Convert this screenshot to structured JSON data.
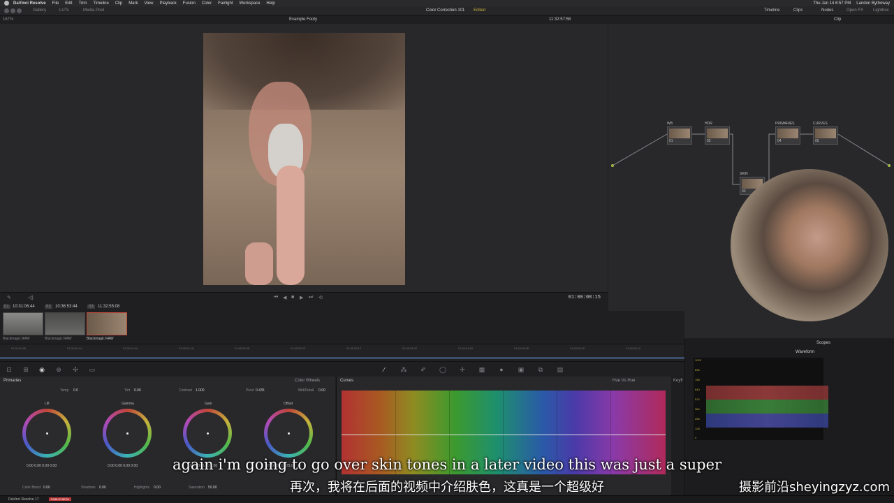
{
  "menubar": {
    "app": "DaVinci Resolve",
    "items": [
      "File",
      "Edit",
      "Trim",
      "Timeline",
      "Clip",
      "Mark",
      "View",
      "Playback",
      "Fusion",
      "Color",
      "Fairlight",
      "Workspace",
      "Help"
    ],
    "clock": "Thu Jan 14  6:57 PM",
    "user": "Landon Bythoway"
  },
  "toolbar": {
    "left": [
      "Gallery",
      "LUTs",
      "Media Pool"
    ],
    "project": "Color Correction 101",
    "status": "Edited",
    "right": [
      "Timeline",
      "Clips",
      "Nodes",
      "Open FX",
      "Lightbox"
    ]
  },
  "viewer": {
    "zoom": "167%",
    "clip_name": "Example Footy",
    "timecode_top": "11:32:57:58",
    "timecode": "01:00:08:15"
  },
  "node_editor": {
    "mode": "Clip",
    "nodes": [
      {
        "label": "WB",
        "num": "01"
      },
      {
        "label": "HDR",
        "num": "02"
      },
      {
        "label": "SKIN",
        "num": "03"
      },
      {
        "label": "PRIMARIES",
        "num": "04"
      },
      {
        "label": "CURVES",
        "num": "05"
      }
    ]
  },
  "clips": {
    "header": [
      {
        "num": "01",
        "tc": "10:31:06:44"
      },
      {
        "num": "02",
        "tc": "10:36:53:44"
      },
      {
        "num": "03",
        "tc": "11:32:55:08"
      }
    ],
    "labels": [
      "Blackmagic RAW",
      "Blackmagic RAW",
      "Blackmagic RAW"
    ]
  },
  "ruler": {
    "ticks": [
      "01:00:00:00",
      "01:00:00:14",
      "01:00:01:04",
      "01:00:01:18",
      "01:00:02:08",
      "01:00:02:22",
      "01:00:03:12",
      "01:00:04:02",
      "01:00:04:16",
      "01:00:05:06",
      "01:00:05:20",
      "01:00:06:10"
    ]
  },
  "primaries": {
    "title": "Primaries",
    "mode": "Color Wheels",
    "params": {
      "temp_label": "Temp",
      "temp": "0.0",
      "tint_label": "Tint",
      "tint": "0.00",
      "contrast_label": "Contrast",
      "contrast": "1.000",
      "pivot_label": "Pivot",
      "pivot": "0.435",
      "mid_label": "Mid/Detail",
      "mid": "0.00"
    },
    "wheels": [
      {
        "name": "Lift",
        "vals": "0.00   0.00   0.00   0.00"
      },
      {
        "name": "Gamma",
        "vals": "0.00   0.00   0.00   0.00"
      },
      {
        "name": "Gain",
        "vals": "1.00   1.00   1.00   1.00"
      },
      {
        "name": "Offset",
        "vals": "25.00   25.00   25.00"
      }
    ],
    "bottom": {
      "color_boost_label": "Color Boost",
      "color_boost": "0.00",
      "shadows_label": "Shadows",
      "shadows": "0.00",
      "highlights_label": "Highlights",
      "highlights": "0.00",
      "saturation_label": "Saturation",
      "saturation": "50.00"
    }
  },
  "curves": {
    "title": "Curves",
    "mode": "Hue Vs Hue",
    "keyframes": "Keyfr"
  },
  "scopes": {
    "title": "Scopes",
    "mode": "Waveform",
    "scale": [
      "1023",
      "896",
      "768",
      "640",
      "512",
      "384",
      "256",
      "128",
      "0"
    ]
  },
  "subtitles": {
    "en": "again i'm going to go over skin tones in a later video this was just a super",
    "zh": "再次，我将在后面的视频中介绍肤色，这真是一个超级好"
  },
  "watermark": "摄影前沿sheyingzyz.com",
  "bottombar": {
    "app": "DaVinci Resolve 17",
    "beta": "PUBLIC BETA"
  },
  "colors": {
    "accent_yellow": "#c8b23a",
    "node_dot": "#a7c23a",
    "timeline_blue": "#3a4e6a"
  }
}
